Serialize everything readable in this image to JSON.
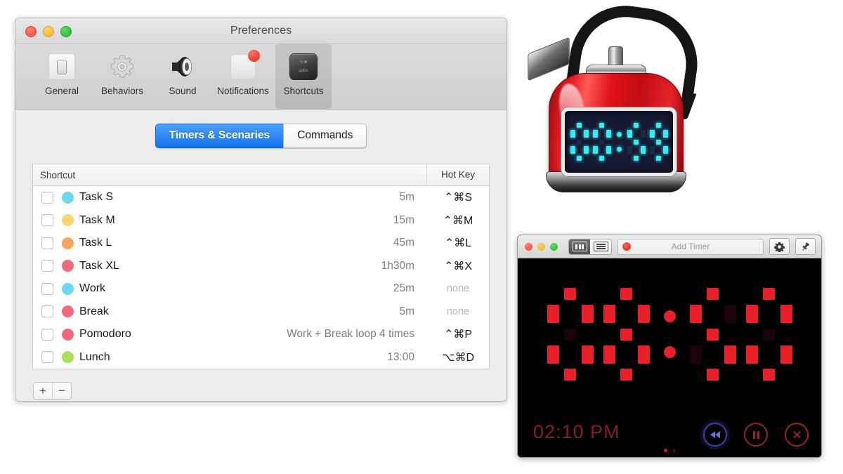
{
  "preferences": {
    "window_title": "Preferences",
    "traffic_lights": [
      "close",
      "minimize",
      "maximize"
    ],
    "toolbar": [
      {
        "label": "General",
        "icon": "device-icon",
        "selected": false
      },
      {
        "label": "Behaviors",
        "icon": "gear-icon",
        "selected": false
      },
      {
        "label": "Sound",
        "icon": "speaker-icon",
        "selected": false
      },
      {
        "label": "Notifications",
        "icon": "notification-icon",
        "selected": false
      },
      {
        "label": "Shortcuts",
        "icon": "keycap-option-icon",
        "selected": true
      }
    ],
    "tabs": [
      {
        "label": "Timers & Scenaries",
        "active": true
      },
      {
        "label": "Commands",
        "active": false
      }
    ],
    "table": {
      "headers": {
        "shortcut": "Shortcut",
        "hotkey": "Hot Key"
      },
      "rows": [
        {
          "name": "Task S",
          "color": "#6ED7F2",
          "duration": "5m",
          "hotkey": "⌃⌘S",
          "hotkey_set": true,
          "checked": false
        },
        {
          "name": "Task M",
          "color": "#F9D46F",
          "duration": "15m",
          "hotkey": "⌃⌘M",
          "hotkey_set": true,
          "checked": false
        },
        {
          "name": "Task L",
          "color": "#F6A463",
          "duration": "45m",
          "hotkey": "⌃⌘L",
          "hotkey_set": true,
          "checked": false
        },
        {
          "name": "Task XL",
          "color": "#EF6A7E",
          "duration": "1h30m",
          "hotkey": "⌃⌘X",
          "hotkey_set": true,
          "checked": false
        },
        {
          "name": "Work",
          "color": "#6ED7F2",
          "duration": "25m",
          "hotkey": "none",
          "hotkey_set": false,
          "checked": false
        },
        {
          "name": "Break",
          "color": "#EF6A7E",
          "duration": "5m",
          "hotkey": "none",
          "hotkey_set": false,
          "checked": false
        },
        {
          "name": "Pomodoro",
          "color": "#EF6A7E",
          "duration": "Work + Break loop 4 times",
          "hotkey": "⌃⌘P",
          "hotkey_set": true,
          "checked": false
        },
        {
          "name": "Lunch",
          "color": "#A8E05A",
          "duration": "13:00",
          "hotkey": "⌥⌘D",
          "hotkey_set": true,
          "checked": false
        }
      ]
    },
    "footer": {
      "add_label": "+",
      "remove_label": "−"
    }
  },
  "kettle": {
    "display_time": "00:59",
    "digits": [
      "0",
      "0",
      "5",
      "9"
    ],
    "segment_color": "#3BE8F0",
    "segment_off_color": "#1d2a45",
    "screen_bg": "#161b33",
    "body_color": "#e01219"
  },
  "timer_window": {
    "titlebar": {
      "view_toggle": [
        {
          "icon": "display-view-icon",
          "selected": true
        },
        {
          "icon": "list-view-icon",
          "selected": false
        }
      ],
      "add_timer_placeholder": "Add Timer",
      "record_dot": "record-icon",
      "settings_icon": "gear-icon",
      "pin_icon": "pushpin-icon"
    },
    "display_time": "08:50",
    "digits": [
      "0",
      "8",
      "5",
      "0"
    ],
    "segment_color": "#E8202A",
    "segment_off_color": "#1a0407",
    "clock": "02:10 PM",
    "controls": [
      {
        "name": "rewind-button",
        "icon": "rewind-icon",
        "highlighted": true
      },
      {
        "name": "pause-button",
        "icon": "pause-icon",
        "highlighted": false
      },
      {
        "name": "stop-button",
        "icon": "close-circle-icon",
        "highlighted": false
      }
    ],
    "page_dots": {
      "count": 2,
      "active_index": 0
    }
  }
}
